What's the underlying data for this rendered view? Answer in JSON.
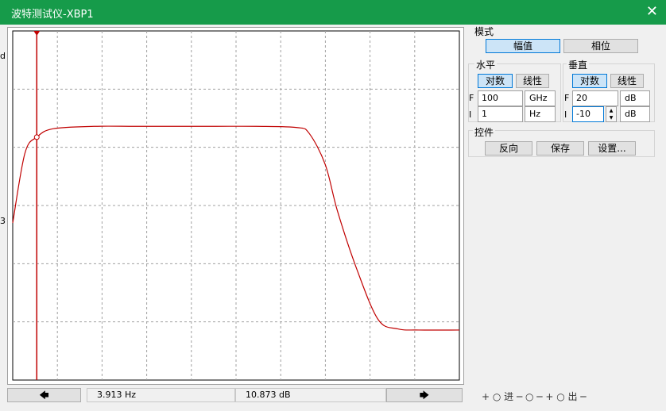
{
  "window": {
    "title": "波特测试仪-XBP1"
  },
  "mode": {
    "label": "模式",
    "magnitude": "幅值",
    "phase": "相位",
    "selected": "magnitude"
  },
  "horizontal": {
    "label": "水平",
    "log": "对数",
    "linear": "线性",
    "selected": "log",
    "F": {
      "label": "F",
      "value": "100",
      "unit": "GHz"
    },
    "I": {
      "label": "I",
      "value": "1",
      "unit": "Hz"
    }
  },
  "vertical": {
    "label": "垂直",
    "log": "对数",
    "linear": "线性",
    "selected": "log",
    "F": {
      "label": "F",
      "value": "20",
      "unit": "dB"
    },
    "I": {
      "label": "I",
      "value": "-10",
      "unit": "dB"
    }
  },
  "controls": {
    "label": "控件",
    "reverse": "反向",
    "save": "保存",
    "settings": "设置..."
  },
  "readout": {
    "frequency": "3.913  Hz",
    "gain": "10.873 dB"
  },
  "footer": {
    "text": "+ ○ 进 ─ ○ ─ + ○ 出 ─"
  },
  "edge_marks": [
    "d",
    "3"
  ],
  "colors": {
    "titlebar": "#169b4a",
    "curve": "#c00000",
    "cursor": "#c00000",
    "grid": "#a0a0a0"
  },
  "chart_data": {
    "type": "line",
    "title": "",
    "xlabel": "",
    "ylabel": "",
    "x_scale": "log",
    "xlim": [
      1,
      100000000000
    ],
    "ylim": [
      -10,
      20
    ],
    "series": [
      {
        "x": [
          1,
          2,
          4,
          10,
          100,
          1000,
          10000,
          100000,
          1000000,
          10000000,
          20000000,
          50000000,
          100000000,
          300000000,
          1000000000,
          3000000000,
          10000000000,
          100000000000
        ],
        "y": [
          3.5,
          9.5,
          10.9,
          11.6,
          11.8,
          11.8,
          11.8,
          11.8,
          11.8,
          11.7,
          11.2,
          8.5,
          4.5,
          -0.5,
          -4.8,
          -5.6,
          -5.7,
          -5.7
        ]
      }
    ],
    "cursor": {
      "x": 3.913,
      "y": 10.873
    },
    "grid": true,
    "grid_divisions": {
      "x": 10,
      "y": 6
    }
  }
}
